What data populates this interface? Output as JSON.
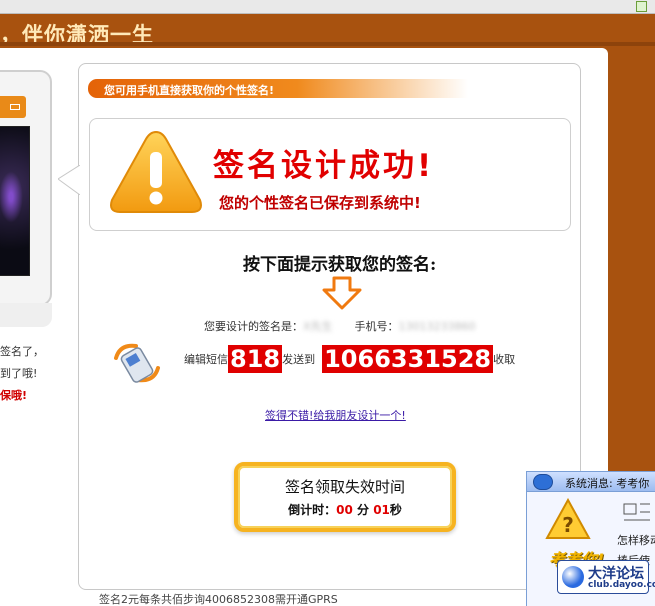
{
  "header": {
    "title": "，伴你潇洒一生"
  },
  "side_notes": {
    "line1": "签名了，",
    "line2": "到了哦!",
    "line3": "保哦!"
  },
  "banner": {
    "text": "您可用手机直接获取你的个性签名!"
  },
  "success": {
    "title": "签名设计成功!",
    "subtitle": "您的个性签名已保存到系统中!"
  },
  "instructions": {
    "title": "按下面提示获取您的签名:",
    "signature_label": "您要设计的签名是：",
    "signature_value": "X先生",
    "phone_label": "手机号：",
    "phone_value": "13013233860",
    "sms_edit": "编辑短信",
    "sms_code": "818",
    "sms_send_to": "发送到",
    "sms_number": "1066331528",
    "sms_receive": "收取"
  },
  "share_link": {
    "text": "签得不错!给我朋友设计一个!"
  },
  "timer": {
    "title": "签名领取失效时间",
    "countdown_label": "倒计时：",
    "minutes": "00",
    "minutes_unit": "分",
    "seconds": "01",
    "seconds_unit": "秒"
  },
  "footer": {
    "note": "签名2元每条共佰步询4006852308需开通GPRS"
  },
  "popup": {
    "title": "系统消息: 考考你",
    "line1": "怎样移动",
    "line2": "棒后使",
    "brand": "考考你!",
    "logo_cn": "大洋论坛",
    "logo_en": "club.dayoo.com"
  },
  "colors": {
    "page_background": "#a8520f",
    "accent_orange": "#e46308",
    "success_red": "#e10000",
    "code_red": "#e00000",
    "link_purple": "#3a1aa6",
    "timer_gold": "#f6b320"
  }
}
